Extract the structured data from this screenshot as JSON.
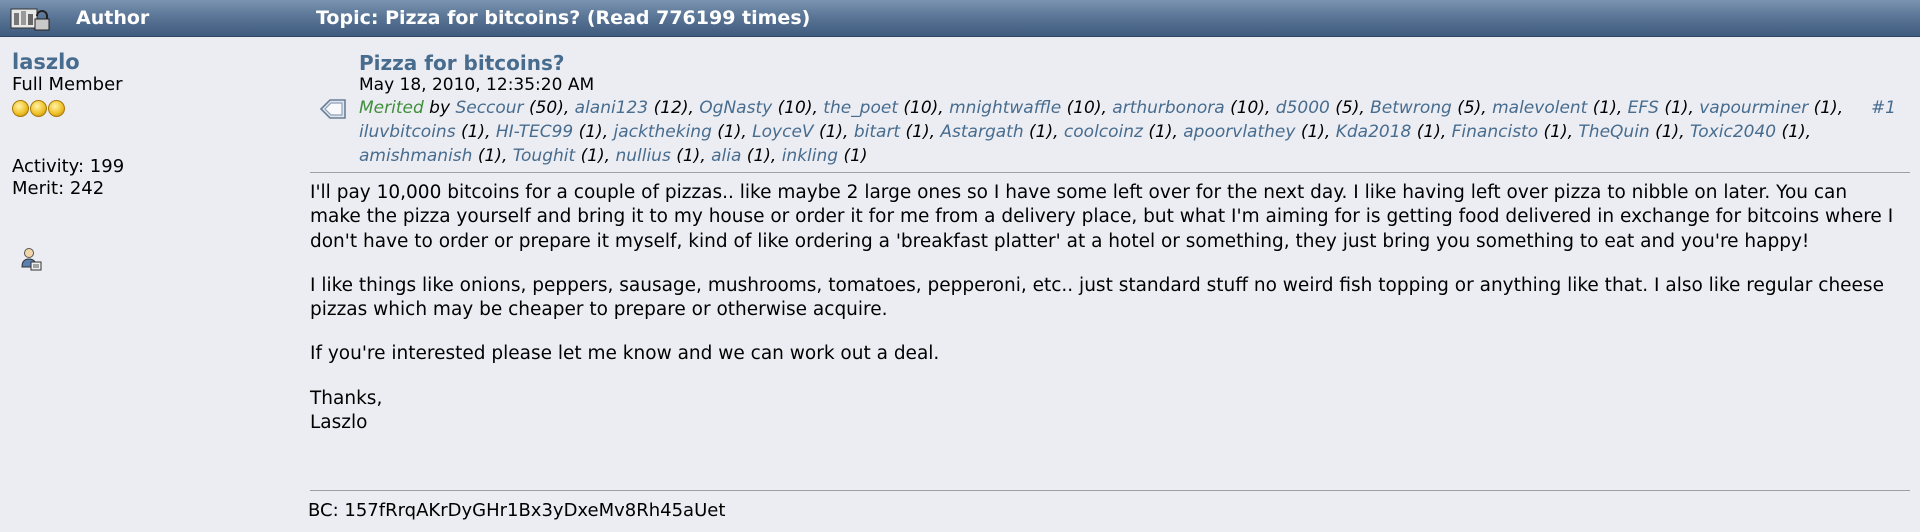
{
  "header": {
    "author_label": "Author",
    "topic_label": "Topic: Pizza for bitcoins?  (Read 776199 times)",
    "icon": "locked-topic-icon"
  },
  "poster": {
    "username": "laszlo",
    "rank": "Full Member",
    "stars_count": 3,
    "activity": "Activity: 199",
    "merit": "Merit: 242",
    "profile_icon": "profile-icon"
  },
  "post": {
    "icon": "post-icon",
    "title": "Pizza for bitcoins?",
    "date": "May 18, 2010, 12:35:20 AM",
    "post_number": "#1",
    "merited_label": "Merited",
    "merited_by": "by",
    "merit_users": [
      {
        "name": "Seccour",
        "count": "(50)"
      },
      {
        "name": "alani123",
        "count": "(12)"
      },
      {
        "name": "OgNasty",
        "count": "(10)"
      },
      {
        "name": "the_poet",
        "count": "(10)"
      },
      {
        "name": "mnightwaffle",
        "count": "(10)"
      },
      {
        "name": "arthurbonora",
        "count": "(10)"
      },
      {
        "name": "d5000",
        "count": "(5)"
      },
      {
        "name": "Betwrong",
        "count": "(5)"
      },
      {
        "name": "malevolent",
        "count": "(1)"
      },
      {
        "name": "EFS",
        "count": "(1)"
      },
      {
        "name": "vapourminer",
        "count": "(1)"
      },
      {
        "name": "iluvbitcoins",
        "count": "(1)"
      },
      {
        "name": "HI-TEC99",
        "count": "(1)"
      },
      {
        "name": "jacktheking",
        "count": "(1)"
      },
      {
        "name": "LoyceV",
        "count": "(1)"
      },
      {
        "name": "bitart",
        "count": "(1)"
      },
      {
        "name": "Astargath",
        "count": "(1)"
      },
      {
        "name": "coolcoinz",
        "count": "(1)"
      },
      {
        "name": "apoorvlathey",
        "count": "(1)"
      },
      {
        "name": "Kda2018",
        "count": "(1)"
      },
      {
        "name": "Financisto",
        "count": "(1)"
      },
      {
        "name": "TheQuin",
        "count": "(1)"
      },
      {
        "name": "Toxic2040",
        "count": "(1)"
      },
      {
        "name": "amishmanish",
        "count": "(1)"
      },
      {
        "name": "Toughit",
        "count": "(1)"
      },
      {
        "name": "nullius",
        "count": "(1)"
      },
      {
        "name": "alia",
        "count": "(1)"
      },
      {
        "name": "inkling",
        "count": "(1)"
      }
    ],
    "body": [
      "I'll pay 10,000 bitcoins for a couple of pizzas.. like maybe 2 large ones so I have some left over for the next day.  I like having left over pizza to nibble on later.  You can make the pizza yourself and bring it to my house or order it for me from a delivery place, but what I'm aiming for is getting food delivered in exchange for bitcoins where I don't have to order or prepare it myself, kind of like ordering a 'breakfast platter' at a hotel or something, they just bring you something to eat and you're happy!",
      "I like things like onions, peppers, sausage, mushrooms, tomatoes, pepperoni, etc.. just standard stuff no weird fish topping or anything like that.  I also like regular cheese pizzas which may be cheaper to prepare or otherwise acquire.",
      "If you're interested please let me know and we can work out a deal.",
      "Thanks,\nLaszlo"
    ],
    "signature": "BC: 157fRrqAKrDyGHr1Bx3yDxeMv8Rh45aUet"
  }
}
